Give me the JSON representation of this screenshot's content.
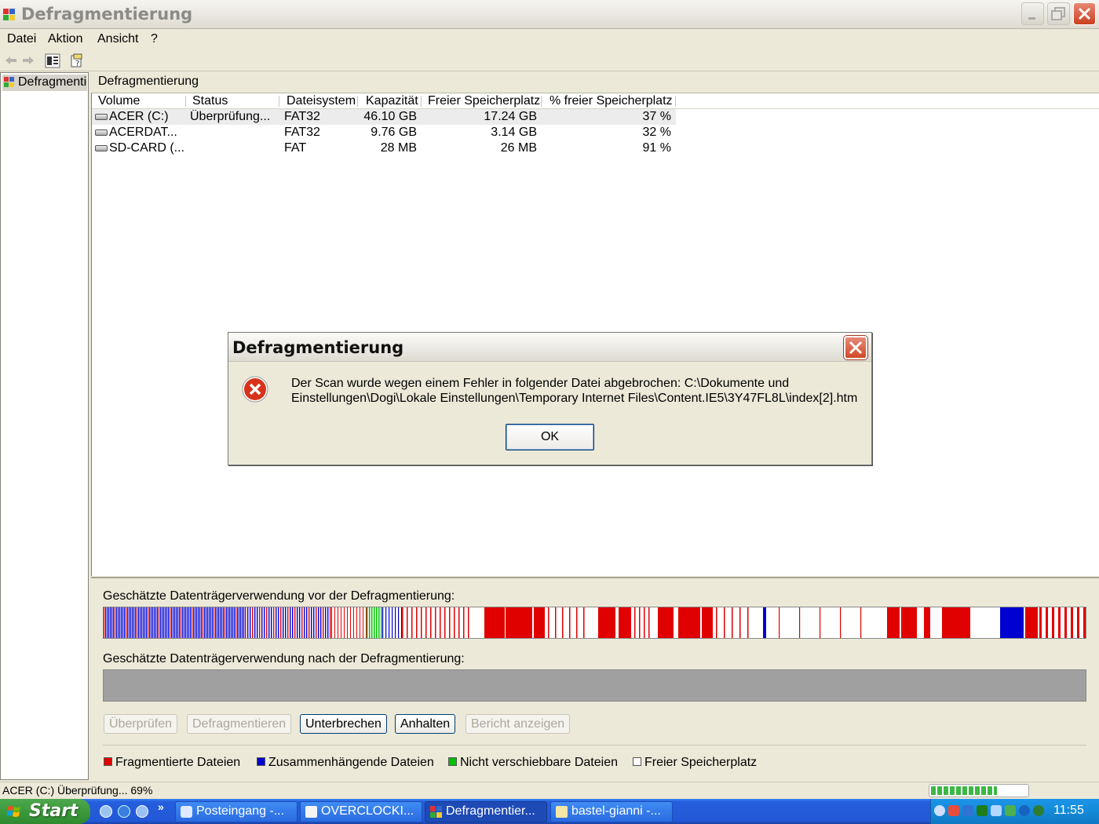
{
  "window": {
    "title": "Defragmentierung"
  },
  "menu": [
    "Datei",
    "Aktion",
    "Ansicht",
    "?"
  ],
  "tree": {
    "item": "Defragmentierung"
  },
  "content": {
    "title": "Defragmentierung"
  },
  "volumes": {
    "columns": [
      "Volume",
      "Status",
      "Dateisystem",
      "Kapazität",
      "Freier Speicherplatz",
      "% freier Speicherplatz"
    ],
    "rows": [
      {
        "volume": "ACER (C:)",
        "status": "Überprüfung...",
        "fs": "FAT32",
        "capacity": "46.10 GB",
        "free": "17.24 GB",
        "pct": "37 %"
      },
      {
        "volume": "ACERDAT...",
        "status": "",
        "fs": "FAT32",
        "capacity": "9.76 GB",
        "free": "3.14 GB",
        "pct": "32 %"
      },
      {
        "volume": "SD-CARD (...",
        "status": "",
        "fs": "FAT",
        "capacity": "28 MB",
        "free": "26 MB",
        "pct": "91 %"
      }
    ]
  },
  "analysis": {
    "before_label": "Geschätzte Datenträgerverwendung vor der Defragmentierung:",
    "after_label": "Geschätzte Datenträgerverwendung nach der Defragmentierung:"
  },
  "buttons": {
    "check": "Überprüfen",
    "defrag": "Defragmentieren",
    "interrupt": "Unterbrechen",
    "pause": "Anhalten",
    "report": "Bericht anzeigen"
  },
  "legend": [
    {
      "label": "Fragmentierte Dateien",
      "color": "#e00000"
    },
    {
      "label": "Zusammenhängende Dateien",
      "color": "#0000d0"
    },
    {
      "label": "Nicht verschiebbare Dateien",
      "color": "#00c000"
    },
    {
      "label": "Freier Speicherplatz",
      "color": "#ffffff"
    }
  ],
  "status": {
    "text": "ACER (C:) Überprüfung... 69%",
    "progress_percent": 69
  },
  "taskbar": {
    "start": "Start",
    "tasks": [
      "Posteingang -...",
      "OVERCLOCKI...",
      "Defragmentier...",
      "bastel-gianni -..."
    ],
    "clock": "11:55"
  },
  "dialog": {
    "title": "Defragmentierung",
    "message_line1": "Der Scan wurde wegen einem Fehler in folgender Datei abgebrochen: C:\\Dokumente und",
    "message_line2": "Einstellungen\\Dogi\\Lokale Einstellungen\\Temporary Internet Files\\Content.IE5\\3Y47FL8L\\index[2].htm",
    "ok": "OK"
  },
  "colors": {
    "fragmented": "#e00000",
    "contiguous": "#0000d0",
    "unmovable": "#00c000",
    "free": "#ffffff",
    "after_bar": "#a0a0a0"
  }
}
